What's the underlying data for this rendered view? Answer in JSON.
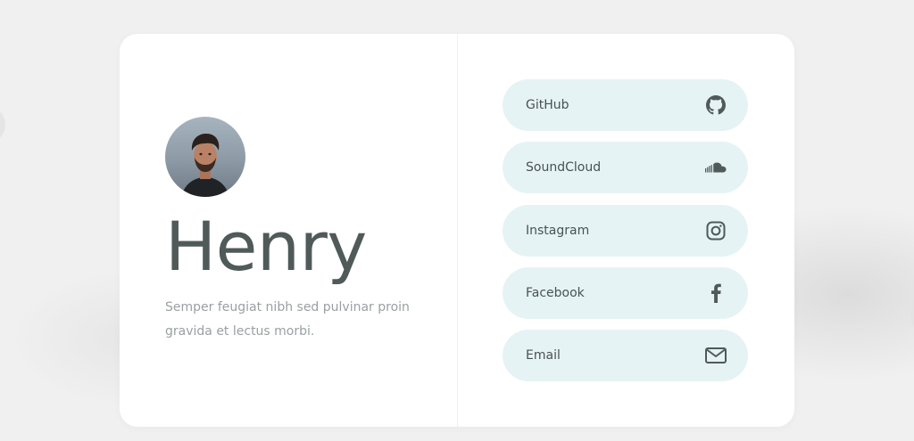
{
  "profile": {
    "name": "Henry",
    "bio": "Semper feugiat nibh sed pulvinar proin gravida et lectus morbi.",
    "avatar": "profile-photo"
  },
  "links": [
    {
      "label": "GitHub",
      "icon": "github-icon"
    },
    {
      "label": "SoundCloud",
      "icon": "soundcloud-icon"
    },
    {
      "label": "Instagram",
      "icon": "instagram-icon"
    },
    {
      "label": "Facebook",
      "icon": "facebook-icon"
    },
    {
      "label": "Email",
      "icon": "mail-icon"
    }
  ],
  "colors": {
    "background": "#f0f0f0",
    "card": "#ffffff",
    "name_text": "#4f5a59",
    "bio_text": "#9aa0a2",
    "link_bg": "#e5f3f4",
    "link_text": "#4a5252",
    "icon": "#4f5a59"
  }
}
